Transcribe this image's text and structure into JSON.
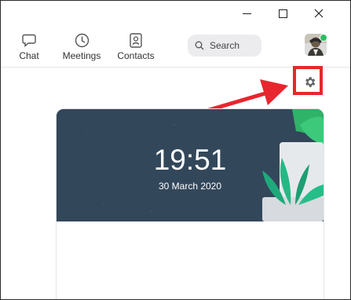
{
  "nav": {
    "items": [
      {
        "label": "Chat",
        "icon": "chat-icon"
      },
      {
        "label": "Meetings",
        "icon": "clock-icon"
      },
      {
        "label": "Contacts",
        "icon": "contact-card-icon"
      }
    ]
  },
  "search": {
    "placeholder": "Search"
  },
  "user": {
    "status": "online"
  },
  "settings": {
    "icon": "gear-icon",
    "highlight_color": "#e8262e"
  },
  "home": {
    "time": "19:51",
    "date": "30 March 2020"
  },
  "colors": {
    "banner": "#34495c",
    "accent_green": "#2dbe60",
    "annotation": "#e8262e"
  }
}
